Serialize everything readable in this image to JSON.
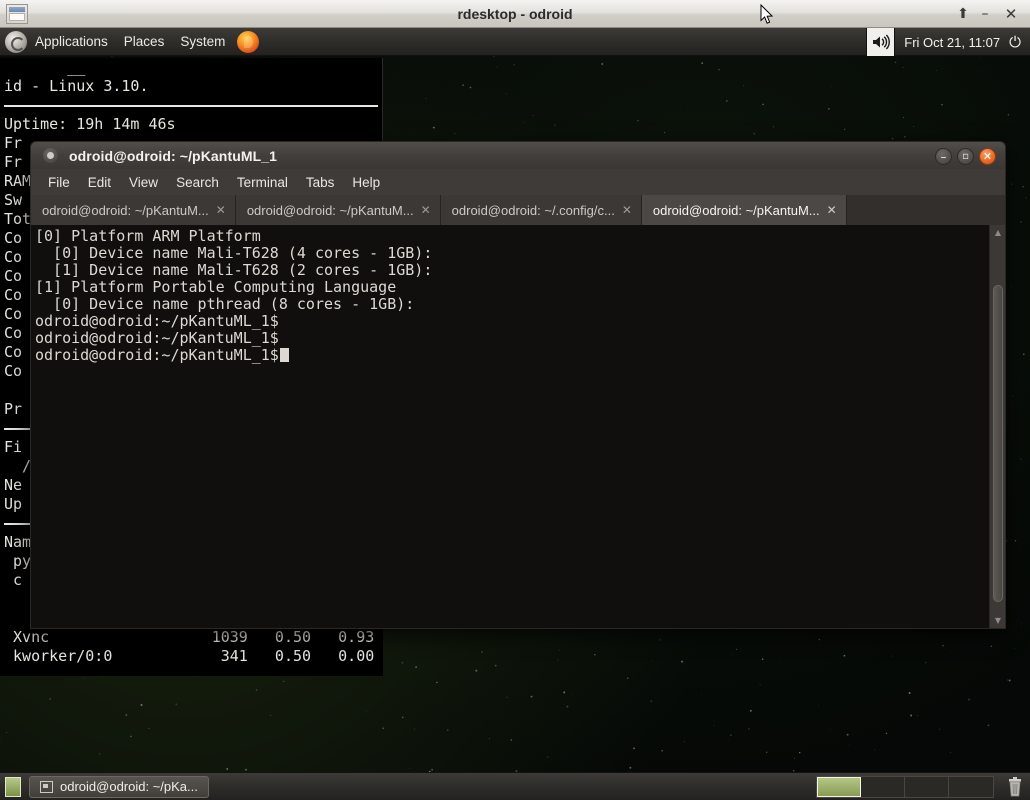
{
  "rdesktop_window": {
    "title": "rdesktop - odroid",
    "icon": "window-icon",
    "buttons": [
      {
        "name": "restore-button",
        "glyph": "⬆"
      },
      {
        "name": "minimize-button",
        "glyph": "–"
      },
      {
        "name": "close-button",
        "glyph": "✕"
      }
    ]
  },
  "gnome_panel": {
    "logo": "gnome-foot-icon",
    "menus": [
      "Applications",
      "Places",
      "System"
    ],
    "launcher": "firefox-icon",
    "volume_icon": "volume-icon",
    "clock": "Fri Oct 21, 11:07",
    "power_icon": "⏻"
  },
  "background_terminal": {
    "lines": [
      {
        "type": "text",
        "text": "       __"
      },
      {
        "type": "text",
        "text": "id - Linux 3.10."
      },
      {
        "type": "sep"
      },
      {
        "type": "text",
        "text": "Uptime: 19h 14m 46s"
      },
      {
        "type": "text",
        "text": "Fr"
      },
      {
        "type": "text",
        "text": "Fr"
      },
      {
        "type": "text",
        "text": "RAM"
      },
      {
        "type": "text",
        "text": "Sw"
      },
      {
        "type": "text",
        "text": "Tot"
      },
      {
        "type": "text",
        "text": "Co"
      },
      {
        "type": "text",
        "text": "Co"
      },
      {
        "type": "text",
        "text": "Co"
      },
      {
        "type": "text",
        "text": "Co"
      },
      {
        "type": "text",
        "text": "Co"
      },
      {
        "type": "text",
        "text": "Co"
      },
      {
        "type": "text",
        "text": "Co"
      },
      {
        "type": "text",
        "text": "Co"
      },
      {
        "type": "text",
        "text": ""
      },
      {
        "type": "text",
        "text": "Pr"
      },
      {
        "type": "sep"
      },
      {
        "type": "text",
        "text": "Fi"
      },
      {
        "type": "text",
        "text": "  /"
      },
      {
        "type": "text",
        "text": "Ne"
      },
      {
        "type": "text",
        "text": "Up"
      },
      {
        "type": "sep"
      },
      {
        "type": "text",
        "text": "Nam"
      },
      {
        "type": "text",
        "text": " py"
      },
      {
        "type": "text",
        "text": " c"
      }
    ],
    "tail_lines": [
      " Xvnc                  1039   0.50   0.93",
      " kworker/0:0            341   0.50   0.00"
    ]
  },
  "terminal_window": {
    "title": "odroid@odroid: ~/pKantuML_1",
    "status_icon": "terminal-status-icon",
    "window_buttons": [
      {
        "name": "minimize-button",
        "glyph": "–"
      },
      {
        "name": "maximize-button",
        "glyph": "▫"
      },
      {
        "name": "close-button",
        "glyph": "✕"
      }
    ],
    "menubar": [
      "File",
      "Edit",
      "View",
      "Search",
      "Terminal",
      "Tabs",
      "Help"
    ],
    "tabs": [
      {
        "label": "odroid@odroid: ~/pKantuM...",
        "active": false,
        "close": "✕"
      },
      {
        "label": "odroid@odroid: ~/pKantuM...",
        "active": false,
        "close": "✕"
      },
      {
        "label": "odroid@odroid: ~/.config/c...",
        "active": false,
        "close": "✕"
      },
      {
        "label": "odroid@odroid: ~/pKantuM...",
        "active": true,
        "close": "✕"
      }
    ],
    "output_lines": [
      "[0] Platform ARM Platform",
      "  [0] Device name Mali-T628 (4 cores - 1GB):",
      "  [1] Device name Mali-T628 (2 cores - 1GB):",
      "[1] Platform Portable Computing Language",
      "  [0] Device name pthread (8 cores - 1GB):",
      "odroid@odroid:~/pKantuML_1$",
      "odroid@odroid:~/pKantuML_1$"
    ],
    "prompt_line": "odroid@odroid:~/pKantuML_1$",
    "scrollbar": {
      "up_arrow": "▲",
      "down_arrow": "▼"
    }
  },
  "taskbar": {
    "show_desktop_icon": "show-desktop-icon",
    "task_button_label": "odroid@odroid: ~/pKa...",
    "workspaces": [
      {
        "active": true
      },
      {
        "active": false
      },
      {
        "active": false
      },
      {
        "active": false
      }
    ],
    "trash_icon": "trash-icon"
  },
  "colors": {
    "panel_bg": "#2e2d2a",
    "terminal_title_bg": "#433f3c",
    "terminal_bg": "#100f0d",
    "close_button": "#e96b28",
    "workspace_active": "#b7c98a"
  }
}
